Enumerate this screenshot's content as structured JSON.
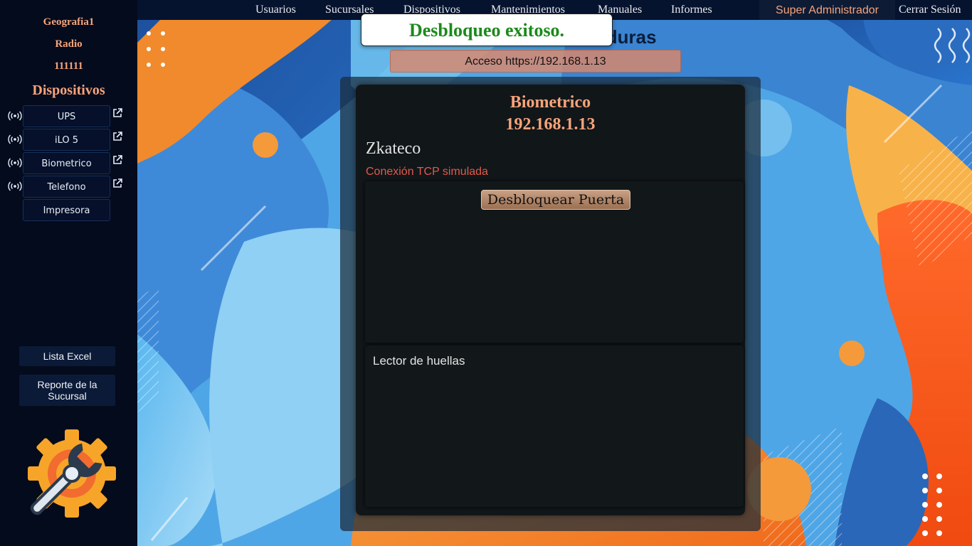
{
  "sidebar": {
    "info": [
      "Geografia1",
      "Radio",
      "111111"
    ],
    "title": "Dispositivos",
    "devices": [
      {
        "label": "UPS",
        "status_icon": "signal-icon",
        "link_icon": "external-link-icon"
      },
      {
        "label": "iLO 5",
        "status_icon": "signal-icon",
        "link_icon": "external-link-icon"
      },
      {
        "label": "Biometrico",
        "status_icon": "signal-icon",
        "link_icon": "external-link-icon"
      },
      {
        "label": "Telefono",
        "status_icon": "signal-icon",
        "link_icon": "external-link-icon"
      },
      {
        "label": "Impresora"
      }
    ],
    "excel_label": "Lista Excel",
    "report_label": "Reporte de la Sucursal",
    "logo_icon": "wrench-gear-icon"
  },
  "nav": {
    "items": [
      "Usuarios",
      "Sucursales",
      "Dispositivos",
      "Mantenimientos",
      "Manuales",
      "Informes"
    ],
    "user_role": "Super Administrador",
    "logout": "Cerrar Sesión"
  },
  "header": {
    "title_visible": "onduras",
    "access_label": "Acceso https://192.168.1.13"
  },
  "toast": {
    "message": "Desbloqueo exitoso.",
    "color": "#1b8a1b"
  },
  "device": {
    "name": "Biometrico",
    "ip": "192.168.1.13",
    "brand": "Zkateco",
    "connection": "Conexión TCP simulada",
    "unlock_label": "Desbloquear Puerta",
    "reader_label": "Lector de huellas"
  },
  "colors": {
    "accent": "#f7a47a",
    "sidebar_bg": "#040b1d",
    "nav_bg": "#06132e",
    "error": "#e25a4b"
  }
}
